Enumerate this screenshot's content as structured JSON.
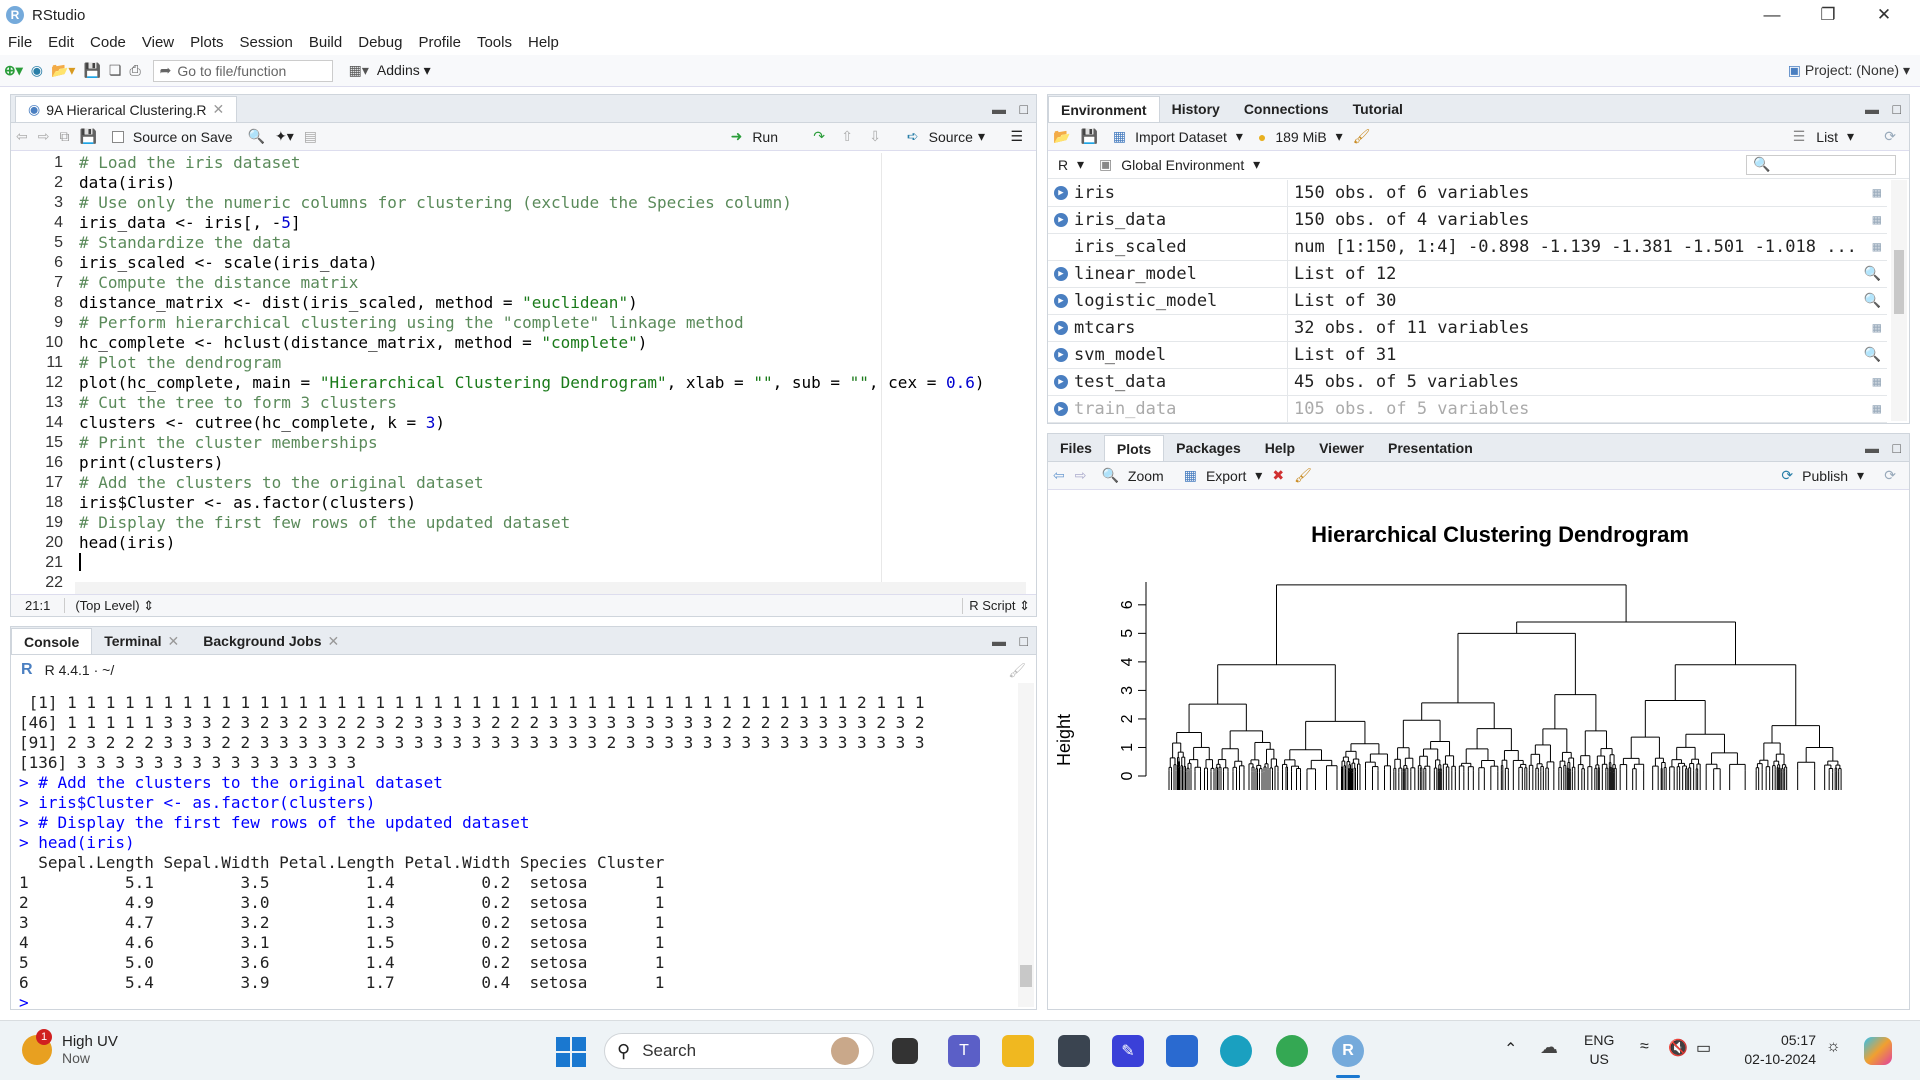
{
  "window": {
    "title": "RStudio"
  },
  "menu": [
    "File",
    "Edit",
    "Code",
    "View",
    "Plots",
    "Session",
    "Build",
    "Debug",
    "Profile",
    "Tools",
    "Help"
  ],
  "toolbar": {
    "goto_placeholder": "Go to file/function",
    "addins": "Addins",
    "project": "Project: (None)"
  },
  "editor": {
    "tab": "9A Hierarical Clustering.R",
    "source_on_save": "Source on Save",
    "run": "Run",
    "source": "Source",
    "lines": [
      "# Load the iris dataset",
      "data(iris)",
      "# Use only the numeric columns for clustering (exclude the Species column)",
      "iris_data <- iris[, -5]",
      "# Standardize the data",
      "iris_scaled <- scale(iris_data)",
      "# Compute the distance matrix",
      "distance_matrix <- dist(iris_scaled, method = \"euclidean\")",
      "# Perform hierarchical clustering using the \"complete\" linkage method",
      "hc_complete <- hclust(distance_matrix, method = \"complete\")",
      "# Plot the dendrogram",
      "plot(hc_complete, main = \"Hierarchical Clustering Dendrogram\", xlab = \"\", sub = \"\", cex = 0.6)",
      "# Cut the tree to form 3 clusters",
      "clusters <- cutree(hc_complete, k = 3)",
      "# Print the cluster memberships",
      "print(clusters)",
      "# Add the clusters to the original dataset",
      "iris$Cluster <- as.factor(clusters)",
      "# Display the first few rows of the updated dataset",
      "head(iris)",
      "",
      ""
    ],
    "status_pos": "21:1",
    "status_level": "(Top Level)",
    "status_type": "R Script"
  },
  "console": {
    "tabs": [
      "Console",
      "Terminal",
      "Background Jobs"
    ],
    "version": "R 4.4.1 · ~/",
    "lines": [
      " [1] 1 1 1 1 1 1 1 1 1 1 1 1 1 1 1 1 1 1 1 1 1 1 1 1 1 1 1 1 1 1 1 1 1 1 1 1 1 1 1 1 1 2 1 1 1",
      "[46] 1 1 1 1 1 3 3 3 2 3 2 3 2 3 2 2 3 2 3 3 3 3 2 2 2 3 3 3 3 3 3 3 3 3 2 2 2 2 3 3 3 3 2 3 2",
      "[91] 2 3 2 2 2 3 3 3 2 2 3 3 3 3 3 2 3 3 3 3 3 3 3 3 3 3 3 3 2 3 3 3 3 3 3 3 3 3 3 3 3 3 3 3 3",
      "[136] 3 3 3 3 3 3 3 3 3 3 3 3 3 3 3",
      "> # Add the clusters to the original dataset",
      "> iris$Cluster <- as.factor(clusters)",
      "> # Display the first few rows of the updated dataset",
      "> head(iris)",
      "  Sepal.Length Sepal.Width Petal.Length Petal.Width Species Cluster",
      "1          5.1         3.5          1.4         0.2  setosa       1",
      "2          4.9         3.0          1.4         0.2  setosa       1",
      "3          4.7         3.2          1.3         0.2  setosa       1",
      "4          4.6         3.1          1.5         0.2  setosa       1",
      "5          5.0         3.6          1.4         0.2  setosa       1",
      "6          5.4         3.9          1.7         0.4  setosa       1",
      "> "
    ]
  },
  "environment": {
    "tabs": [
      "Environment",
      "History",
      "Connections",
      "Tutorial"
    ],
    "import": "Import Dataset",
    "memory": "189 MiB",
    "view": "List",
    "lang": "R",
    "scope": "Global Environment",
    "rows": [
      {
        "name": "iris",
        "value": "150 obs. of 6 variables"
      },
      {
        "name": "iris_data",
        "value": "150 obs. of 4 variables"
      },
      {
        "name": "iris_scaled",
        "value": "num [1:150, 1:4] -0.898 -1.139 -1.381 -1.501 -1.018 ..."
      },
      {
        "name": "linear_model",
        "value": "List of  12"
      },
      {
        "name": "logistic_model",
        "value": "List of  30"
      },
      {
        "name": "mtcars",
        "value": "32 obs. of 11 variables"
      },
      {
        "name": "svm_model",
        "value": "List of  31"
      },
      {
        "name": "test_data",
        "value": "45 obs. of 5 variables"
      },
      {
        "name": "train_data",
        "value": "105 obs. of 5 variables"
      }
    ]
  },
  "files": {
    "tabs": [
      "Files",
      "Plots",
      "Packages",
      "Help",
      "Viewer",
      "Presentation"
    ],
    "zoom": "Zoom",
    "export": "Export",
    "publish": "Publish"
  },
  "plot": {
    "title": "Hierarchical Clustering Dendrogram",
    "ylabel": "Height",
    "yticks": [
      "0",
      "1",
      "2",
      "3",
      "4",
      "5",
      "6"
    ]
  },
  "taskbar": {
    "weather": "High UV",
    "weather_sub": "Now",
    "search": "Search",
    "lang1": "ENG",
    "lang2": "US",
    "time": "05:17",
    "date": "02-10-2024"
  }
}
